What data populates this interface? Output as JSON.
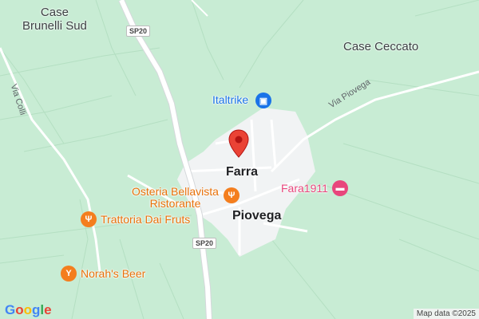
{
  "map": {
    "places": {
      "case_brunelli_line1": "Case",
      "case_brunelli_line2": "Brunelli Sud",
      "case_ceccato": "Case Ceccato",
      "farra": "Farra",
      "piovega": "Piovega"
    },
    "roads": {
      "sp20_top": "SP20",
      "sp20_bottom": "SP20",
      "via_colli": "Via Colli",
      "via_piovega": "Via Piovega"
    },
    "pois": {
      "italtrike": "Italtrike",
      "fara1911": "Fara1911",
      "osteria_line1": "Osteria Bellavista",
      "osteria_line2": "Ristorante",
      "trattoria": "Trattoria Dai Fruts",
      "norahs": "Norah's Beer"
    },
    "colors": {
      "land": "#c8ecd4",
      "town_area": "#f1f3f4",
      "road": "#ffffff",
      "restaurant": "#f47e1e",
      "shopping": "#1a73e8",
      "lodging": "#e8467c",
      "marker": "#ea4335"
    },
    "icons": {
      "italtrike": "shopping-bag-icon",
      "fara1911": "bed-icon",
      "restaurant": "fork-knife-icon",
      "bar": "cocktail-icon",
      "marker": "location-pin-icon"
    },
    "attribution": "Map data ©2025",
    "logo": "Google"
  }
}
